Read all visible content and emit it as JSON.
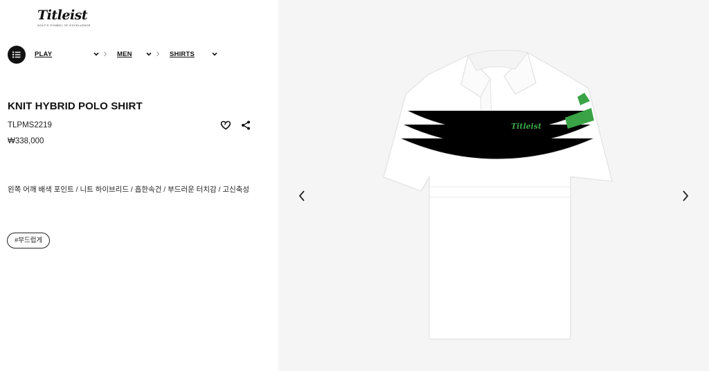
{
  "brand": {
    "name": "Titleist",
    "tagline": "GOLF'S SYMBOL OF EXCELLENCE"
  },
  "breadcrumb": {
    "items": [
      {
        "label": "PLAY"
      },
      {
        "label": "MEN"
      },
      {
        "label": "SHIRTS"
      }
    ]
  },
  "product": {
    "title": "KNIT HYBRID POLO SHIRT",
    "sku": "TLPMS2219",
    "price": "₩338,000",
    "description": "왼쪽 어깨 배색 포인트 / 니트 하이브리드 / 흡한속건 / 부드러운 터치감 / 고신축성",
    "tags": [
      "#부드럽게"
    ],
    "image": {
      "chest_logo_text": "Titleist",
      "accent_color": "#3aa346"
    }
  },
  "icons": {
    "menu": "list-menu-icon",
    "heart": "heart-icon",
    "share": "share-icon",
    "prev": "chevron-left-icon",
    "next": "chevron-right-icon"
  },
  "colors": {
    "image_background": "#f5f5f5",
    "text": "#111111"
  }
}
